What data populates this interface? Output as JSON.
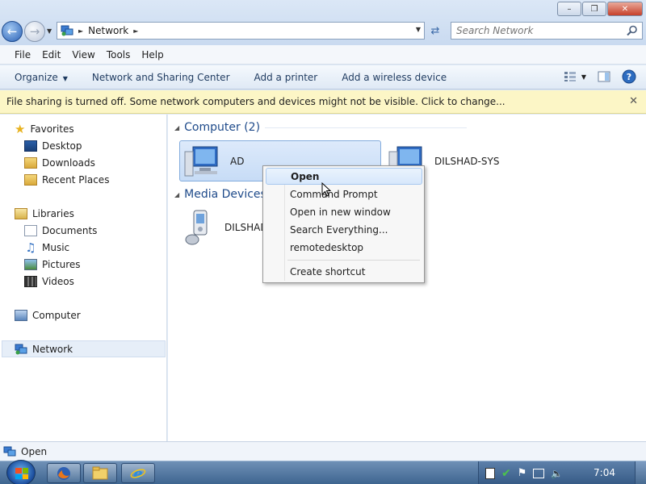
{
  "window": {
    "controls": {
      "minimize": "–",
      "maximize": "❐",
      "close": "✕"
    }
  },
  "address_bar": {
    "path": [
      "Network"
    ],
    "icon": "network-icon"
  },
  "search": {
    "placeholder": "Search Network"
  },
  "menu": [
    "File",
    "Edit",
    "View",
    "Tools",
    "Help"
  ],
  "commands": {
    "organize": "Organize",
    "items": [
      "Network and Sharing Center",
      "Add a printer",
      "Add a wireless device"
    ]
  },
  "infobar": {
    "text": "File sharing is turned off. Some network computers and devices might not be visible. Click to change..."
  },
  "sidebar": {
    "favorites": {
      "label": "Favorites",
      "items": [
        "Desktop",
        "Downloads",
        "Recent Places"
      ]
    },
    "libraries": {
      "label": "Libraries",
      "items": [
        "Documents",
        "Music",
        "Pictures",
        "Videos"
      ]
    },
    "computer": "Computer",
    "network": "Network"
  },
  "content": {
    "groups": [
      {
        "title": "Computer (2)",
        "items": [
          "AD",
          "DILSHAD-SYS"
        ]
      },
      {
        "title": "Media Devices",
        "items": [
          "DILSHAD"
        ]
      }
    ]
  },
  "context_menu": {
    "items": [
      "Open",
      "Command Prompt",
      "Open in new window",
      "Search Everything...",
      "remotedesktop"
    ],
    "after_separator": [
      "Create shortcut"
    ]
  },
  "status": {
    "text": "Open"
  },
  "taskbar": {
    "clock": "7:04",
    "pinned": [
      "firefox-icon",
      "explorer-folder-icon",
      "internet-explorer-icon"
    ]
  },
  "colors": {
    "accent": "#1e4a8a",
    "infobar": "#fcf6c6",
    "selection": "#c7dcf6",
    "taskbar": "#3e6590"
  }
}
